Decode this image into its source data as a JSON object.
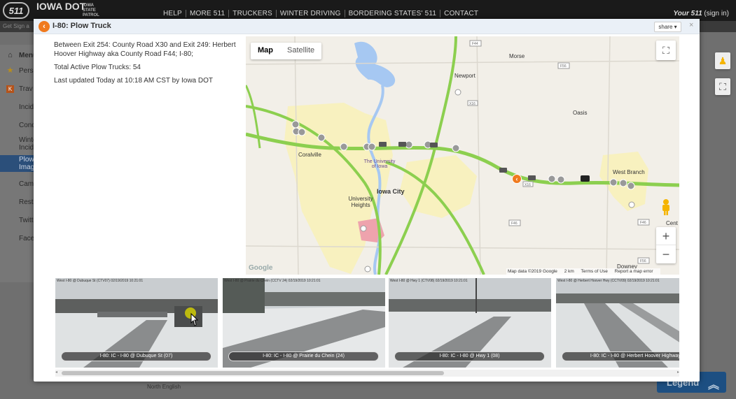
{
  "header": {
    "logo_511": "511",
    "logo_dot": "IOWA DOT",
    "logo_patrol": "IOWA STATE PATROL",
    "nav": [
      "HELP",
      "MORE 511",
      "TRUCKERS",
      "WINTER DRIVING",
      "BORDERING STATES' 511",
      "CONTACT"
    ],
    "signin_brand": "Your 511",
    "signin_link": "(sign in)",
    "sub_text": "Get Sign a"
  },
  "side_menu": {
    "items": [
      {
        "label": "Menu",
        "icon": "home-icon"
      },
      {
        "label": "Pers",
        "icon": "star-icon"
      },
      {
        "label": "Trav",
        "icon": "traveler-icon"
      },
      {
        "label": "Incid",
        "icon": ""
      },
      {
        "label": "Cond",
        "icon": ""
      },
      {
        "label": "Winte Incid",
        "icon": ""
      },
      {
        "label": "Plow Imag",
        "icon": ""
      },
      {
        "label": "Cam",
        "icon": ""
      },
      {
        "label": "Rest",
        "icon": ""
      },
      {
        "label": "Twitt",
        "icon": ""
      },
      {
        "label": "Face",
        "icon": ""
      }
    ],
    "selected_index": 6
  },
  "legend": {
    "label": "Legend"
  },
  "modal": {
    "title": "I-80: Plow Truck",
    "share_label": "share ▾",
    "close_label": "×",
    "location": "Between Exit 254: County Road X30 and Exit 249: Herbert Hoover Highway aka County Road F44; I-80;",
    "active_trucks": "Total Active Plow Trucks: 54",
    "updated": "Last updated Today at 10:18 AM CST by Iowa DOT"
  },
  "map": {
    "tabs": [
      "Map",
      "Satellite"
    ],
    "active_tab": "Map",
    "places": [
      {
        "name": "Morse"
      },
      {
        "name": "Newport"
      },
      {
        "name": "Oasis"
      },
      {
        "name": "Coralville"
      },
      {
        "name": "The University of Iowa"
      },
      {
        "name": "Iowa City"
      },
      {
        "name": "University Heights"
      },
      {
        "name": "West Branch"
      },
      {
        "name": "Downey"
      },
      {
        "name": "Cent"
      }
    ],
    "shields": [
      "F56",
      "X16",
      "X16",
      "F46",
      "F46",
      "F56",
      "F44"
    ],
    "attribution": [
      "Map data ©2019 Google",
      "2 km",
      "Terms of Use",
      "Report a map error"
    ],
    "google_mark": "Google",
    "road_color": "#8ccf4f",
    "plow_color": "#f07a1e"
  },
  "cameras": [
    {
      "caption": "I-80: IC - I-80 @ Dubuque St (07)",
      "stamp": "West    I-80 @ Dubuque St (CTV07) 02/19/2019 10:21:01"
    },
    {
      "caption": "I-80: IC - I-80 @ Prairie du Chein (24)",
      "stamp": "West    I-80 @ Prairie du Chein (CCTV 24) 02/19/2019 10:21:01"
    },
    {
      "caption": "I-80: IC - I-80 @ Hwy 1 (08)",
      "stamp": "West    I-80 @ Hwy 1 (CTV08) 02/19/2019 10:21:01"
    },
    {
      "caption": "I-80: IC - I-80 @ Herbert Hoover Highway (",
      "stamp": "West    I-80 @ Herbert Hoover Hwy (CCTV09) 02/19/2019 10:21:01"
    }
  ],
  "background_text": [
    "North English"
  ]
}
